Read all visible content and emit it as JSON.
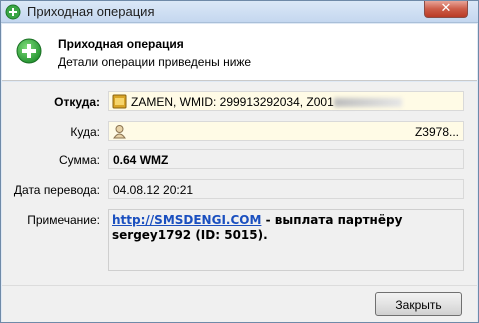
{
  "window": {
    "title": "Приходная операция"
  },
  "header": {
    "title": "Приходная операция",
    "subtitle": "Детали операции приведены ниже"
  },
  "fields": {
    "from": {
      "label": "Откуда:",
      "value": "ZAMEN, WMID: 299913292034, Z001"
    },
    "to": {
      "label": "Куда:",
      "value": "Z3978..."
    },
    "amount": {
      "label": "Сумма:",
      "value": "0.64 WMZ"
    },
    "date": {
      "label": "Дата перевода:",
      "value": "04.08.12 20:21"
    },
    "note": {
      "label": "Примечание:",
      "link": "http://SMSDENGI.COM",
      "text": " - выплата партнёру sergey1792 (ID: 5015)."
    }
  },
  "buttons": {
    "close": "Закрыть"
  },
  "colors": {
    "accent_green": "#2fa13a",
    "link": "#1a4fbf",
    "close_red": "#c94a35"
  }
}
